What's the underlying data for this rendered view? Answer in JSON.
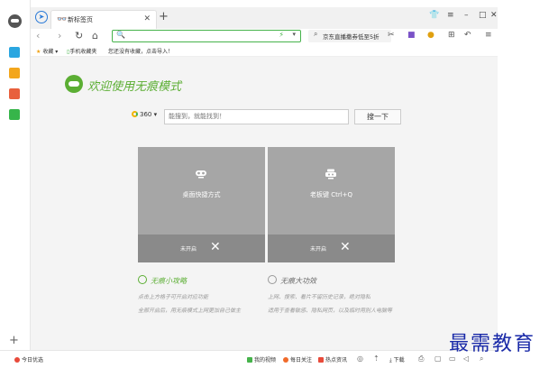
{
  "tab": {
    "title": "新标签页"
  },
  "toolbar": {
    "address_value": "",
    "search_text": "京东直播撒券低至5折"
  },
  "bookmarks": {
    "label": "收藏",
    "mobile": "手机收藏夹",
    "empty_hint": "您还没有收藏，点击导入！"
  },
  "content": {
    "welcome": "欢迎使用无痕模式",
    "engine": "360",
    "search_placeholder": "能搜到，就能找到！",
    "search_button": "搜一下",
    "cards": [
      {
        "title": "桌面快捷方式",
        "status": "未开启"
      },
      {
        "title": "老板键 Ctrl+Q",
        "status": "未开启"
      }
    ],
    "tips": [
      {
        "title": "无痕小攻略",
        "lines": [
          "点击上方格子可开启对应功能",
          "全部开启后，用无痕模式上网更加自己做主"
        ]
      },
      {
        "title": "无痕大功效",
        "lines": [
          "上网、搜索、看片不留历史记录，绝对隐私",
          "适用于查看敏感、隐私网页，以及临时用别人电脑等"
        ]
      }
    ]
  },
  "statusbar": {
    "left": "今日优选",
    "video": "我的视频",
    "follow": "每日关注",
    "news": "热点资讯",
    "download": "下载"
  },
  "watermark": "最需教育",
  "colors": {
    "accent": "#5bae33",
    "card": "#a6a6a6",
    "card_footer": "#8a8a8a"
  }
}
